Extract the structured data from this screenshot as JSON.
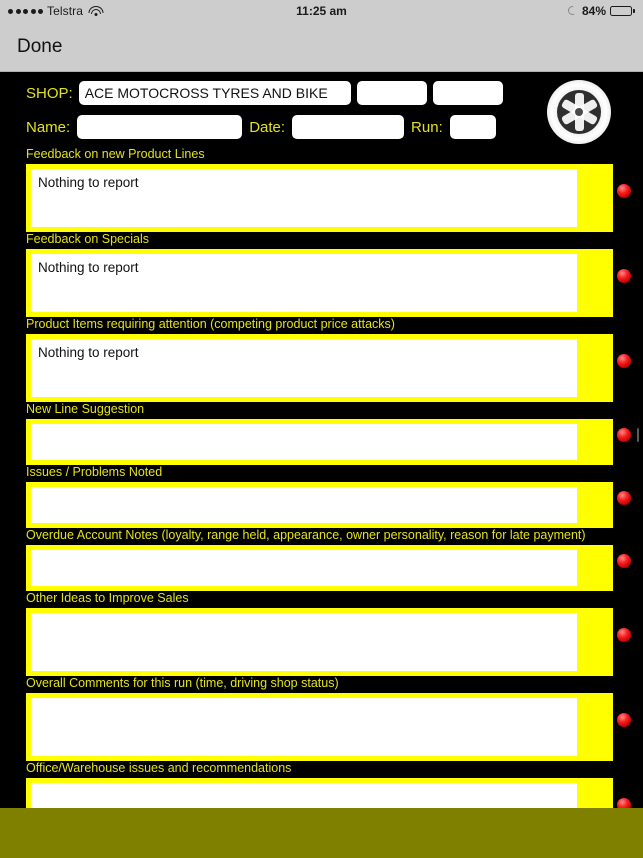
{
  "status_bar": {
    "carrier": "Telstra",
    "signal_dots": 5,
    "wifi_icon": "wifi-icon",
    "time": "11:25 am",
    "moon_icon": "moon-icon",
    "battery_percent": "84%",
    "battery_level": 84
  },
  "nav_bar": {
    "done_label": "Done"
  },
  "header": {
    "shop_label": "SHOP:",
    "shop_value": "ACE MOTOCROSS TYRES AND BIKE",
    "shop_extra_1": "",
    "shop_extra_2": "",
    "name_label": "Name:",
    "name_value": "",
    "date_label": "Date:",
    "date_value": "",
    "run_label": "Run:",
    "run_value": "",
    "logo_icon": "wheel-icon"
  },
  "colors": {
    "background": "#000000",
    "label_yellow": "#e2e21c",
    "box_yellow": "#ffff00",
    "input_white": "#ffffff",
    "status_bar_gray": "#cdcdcd",
    "footer_olive": "#808000",
    "indicator_red": "#f52020"
  },
  "sections": [
    {
      "label": "Feedback on new Product Lines",
      "value": "Nothing to report",
      "size": "tall",
      "indicator": "red-dot",
      "has_scroll_indicator": false
    },
    {
      "label": "Feedback on Specials",
      "value": "Nothing to report",
      "size": "tall",
      "indicator": "red-dot",
      "has_scroll_indicator": false
    },
    {
      "label": "Product Items requiring attention (competing product price attacks)",
      "value": "Nothing to report",
      "size": "tall",
      "indicator": "red-dot",
      "has_scroll_indicator": false
    },
    {
      "label": "New Line Suggestion",
      "value": "",
      "size": "short",
      "indicator": "red-dot",
      "has_scroll_indicator": true
    },
    {
      "label": "Issues / Problems Noted",
      "value": "",
      "size": "short",
      "indicator": "red-dot",
      "has_scroll_indicator": false
    },
    {
      "label": "Overdue Account Notes (loyalty, range held, appearance, owner personality, reason for late payment)",
      "value": "",
      "size": "short",
      "indicator": "red-dot",
      "has_scroll_indicator": false
    },
    {
      "label": "Other Ideas to Improve Sales",
      "value": "",
      "size": "tall",
      "indicator": "red-dot",
      "has_scroll_indicator": false
    },
    {
      "label": "Overall Comments for this run (time, driving shop status)",
      "value": "",
      "size": "tall",
      "indicator": "red-dot",
      "has_scroll_indicator": false
    },
    {
      "label": "Office/Warehouse issues and recommendations",
      "value": "",
      "size": "tall",
      "indicator": "red-dot",
      "has_scroll_indicator": false
    }
  ]
}
